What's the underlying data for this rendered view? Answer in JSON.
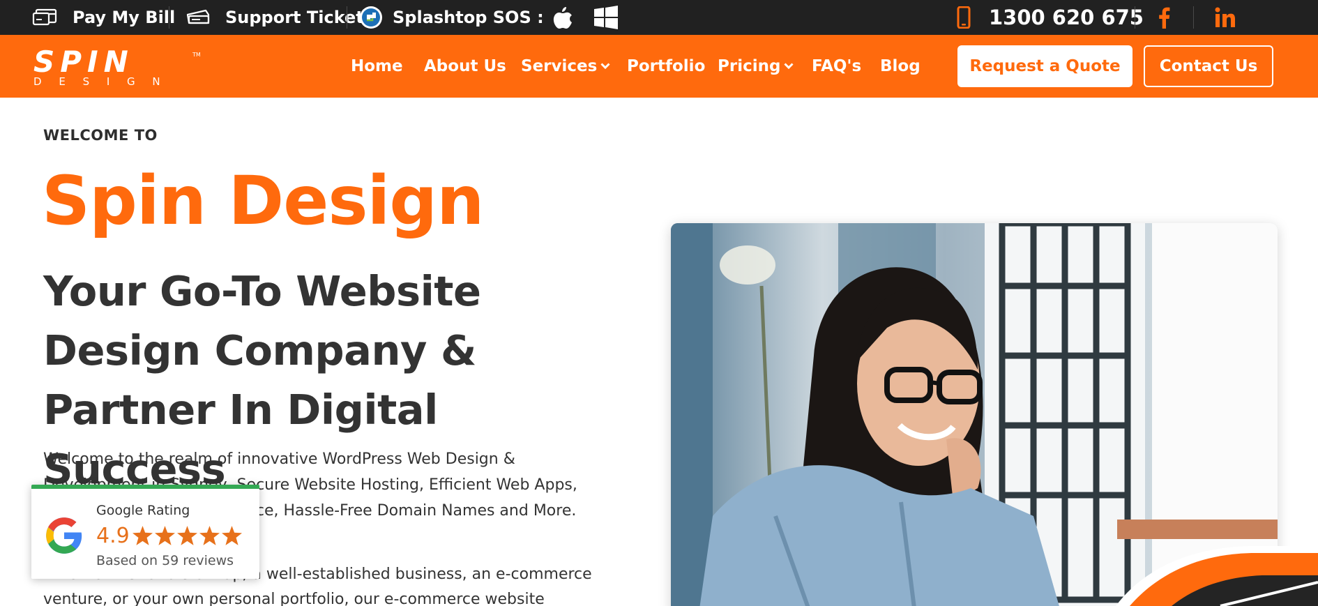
{
  "topbar": {
    "pay_bill": "Pay My Bill",
    "support": "Support Ticket",
    "splashtop": "Splashtop SOS :",
    "phone": "1300 620 675",
    "icons": [
      "credit-card-icon",
      "ticket-icon",
      "splashtop-icon",
      "apple-icon",
      "windows-icon",
      "phone-icon",
      "facebook-icon",
      "linkedin-icon"
    ]
  },
  "nav": {
    "logo_text": "SPIN",
    "logo_sub": "D E S I G N",
    "logo_tm": "TM",
    "items": [
      "Home",
      "About Us",
      "Services",
      "Portfolio",
      "Pricing",
      "FAQ's",
      "Blog"
    ],
    "request_quote": "Request a Quote",
    "contact": "Contact Us"
  },
  "hero": {
    "welcome": "WELCOME TO",
    "brand": "Spin Design",
    "headline_lines": [
      "Your Go-To Website",
      "Design Company &",
      "Partner In Digital Success"
    ],
    "intro_lines": [
      "Welcome to the realm of innovative WordPress Web Design &",
      "Development in Sydney, Secure Website Hosting, Efficient Web Apps,",
      "Reliable Website Maintenance, Hassle-Free Domain Names and More."
    ],
    "intro2_lines": [
      "Whether it's for a start-up, a well-established business, an e-commerce",
      "venture, or your own personal portfolio, our e-commerce website"
    ]
  },
  "rating": {
    "title": "Google Rating",
    "score": "4.9",
    "stars": 5,
    "count": "Based on 59 reviews"
  },
  "colors": {
    "brand_orange": "#ff6a0d",
    "topbar_bg": "#212121",
    "text_dark": "#333333",
    "star": "#e7711b",
    "google_green": "#34a853"
  }
}
